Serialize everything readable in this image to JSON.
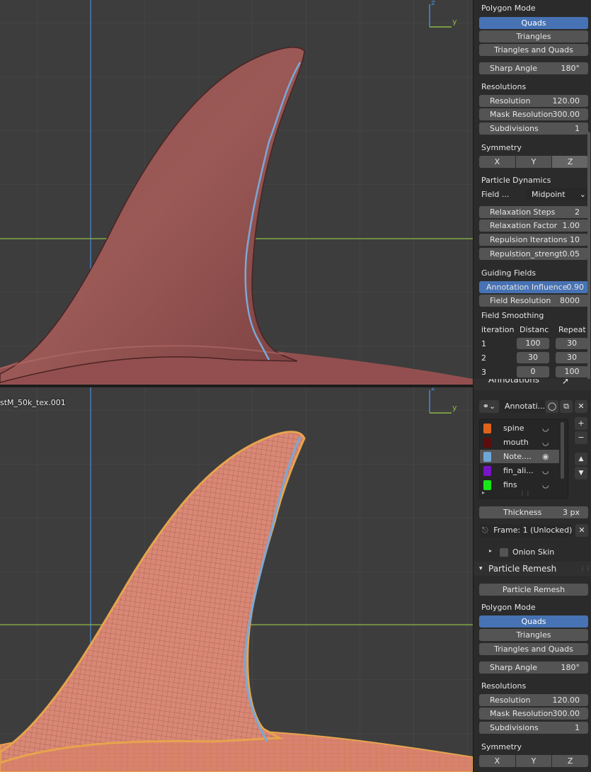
{
  "colors": {
    "viewport_bg": "#3d3d3d",
    "grid_line": "#4a4a4a",
    "axis_x": "#8cb846",
    "axis_z": "#4a8bd4",
    "mesh_base": "#9e5a58",
    "wire": "#e7a44d",
    "annotation_stroke": "#7aa8d6",
    "panel_bg": "#2b2b2b",
    "button": "#545454",
    "selected": "#4772b3"
  },
  "viewport_top": {
    "gizmo": {
      "z": "z",
      "y": "y"
    }
  },
  "viewport_bottom": {
    "object_label": "stM_50k_tex.001",
    "gizmo": {
      "z": "z",
      "y": "y"
    }
  },
  "panel_top": {
    "polygon_mode_label": "Polygon Mode",
    "poly_modes": [
      "Quads",
      "Triangles",
      "Triangles and Quads"
    ],
    "sharp_angle_label": "Sharp Angle",
    "sharp_angle_value": "180°",
    "resolutions_label": "Resolutions",
    "resolution_label": "Resolution",
    "resolution_value": "120.00",
    "mask_resolution_label": "Mask Resolution",
    "mask_resolution_value": "300.00",
    "subdivisions_label": "Subdivisions",
    "subdivisions_value": "1",
    "symmetry_label": "Symmetry",
    "sym_x": "X",
    "sym_y": "Y",
    "sym_z": "Z",
    "particle_dynamics_label": "Particle Dynamics",
    "field_label": "Field ...",
    "field_value": "Midpoint",
    "relax_steps_label": "Relaxation Steps",
    "relax_steps_value": "2",
    "relax_factor_label": "Relaxation Factor",
    "relax_factor_value": "1.00",
    "repulsion_iter_label": "Repulsion Iterations",
    "repulsion_iter_value": "10",
    "repulsion_str_label": "Repulstion_strengt",
    "repulsion_str_value": "0.05",
    "guiding_fields_label": "Guiding Fields",
    "annot_influence_label": "Annotation Influence",
    "annot_influence_value": "0.90",
    "field_res_label": "Field Resolution",
    "field_res_value": "8000",
    "field_smoothing_label": "Field Smoothing",
    "smoothing_headers": [
      "iteration",
      "Distanc",
      "Repeat"
    ],
    "smoothing_rows": [
      {
        "i": "1",
        "d": "100",
        "r": "30"
      },
      {
        "i": "2",
        "d": "30",
        "r": "30"
      },
      {
        "i": "3",
        "d": "0",
        "r": "100"
      }
    ]
  },
  "annotations": {
    "header": "Annotations",
    "datablock_name": "Annotati...",
    "layers": [
      {
        "name": "spine",
        "color": "#e0631a"
      },
      {
        "name": "mouth",
        "color": "#5e0d0d"
      },
      {
        "name": "Note....",
        "color": "#6fa6d8"
      },
      {
        "name": "fin_ali...",
        "color": "#7a14c8"
      },
      {
        "name": "fins",
        "color": "#18e818"
      }
    ],
    "thickness_label": "Thickness",
    "thickness_value": "3 px",
    "frame_label": "Frame: 1 (Unlocked)",
    "onion_skin_label": "Onion Skin"
  },
  "particle_remesh": {
    "header": "Particle Remesh",
    "run_button": "Particle Remesh",
    "polygon_mode_label": "Polygon Mode",
    "poly_modes": [
      "Quads",
      "Triangles",
      "Triangles and Quads"
    ],
    "sharp_angle_label": "Sharp Angle",
    "sharp_angle_value": "180°",
    "resolutions_label": "Resolutions",
    "resolution_label": "Resolution",
    "resolution_value": "120.00",
    "mask_resolution_label": "Mask Resolution",
    "mask_resolution_value": "300.00",
    "subdivisions_label": "Subdivisions",
    "subdivisions_value": "1",
    "symmetry_label": "Symmetry",
    "sym_x": "X",
    "sym_y": "Y",
    "sym_z": "Z"
  }
}
